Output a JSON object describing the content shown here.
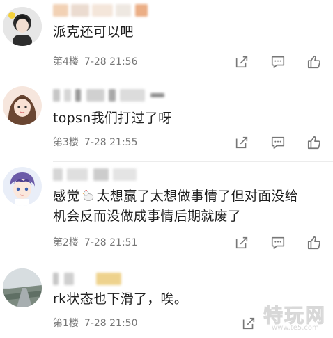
{
  "comments": [
    {
      "content": "派克还可以吧",
      "floor": "第4楼",
      "time": "7-28 21:56"
    },
    {
      "content": "topsn我们打过了呀",
      "floor": "第3楼",
      "time": "7-28 21:55"
    },
    {
      "content_line1_part1": "感觉",
      "content_line1_part2": "太想赢了太想做事情了但对面没给",
      "content_line2": "机会反而没做成事情后期就废了",
      "floor": "第2楼",
      "time": "7-28 21:51"
    },
    {
      "content": "rk状态也下滑了，唉。",
      "floor": "第1楼",
      "time": "7-28 21:50"
    }
  ],
  "watermark": {
    "text": "特玩网",
    "sub": "www.te5.com"
  },
  "icons": {
    "share": "share-icon",
    "reply": "reply-icon",
    "like": "like-icon"
  },
  "colors": {
    "meta_text": "#777777",
    "icon_gray": "#777777",
    "content_text": "#1f1f1f"
  }
}
